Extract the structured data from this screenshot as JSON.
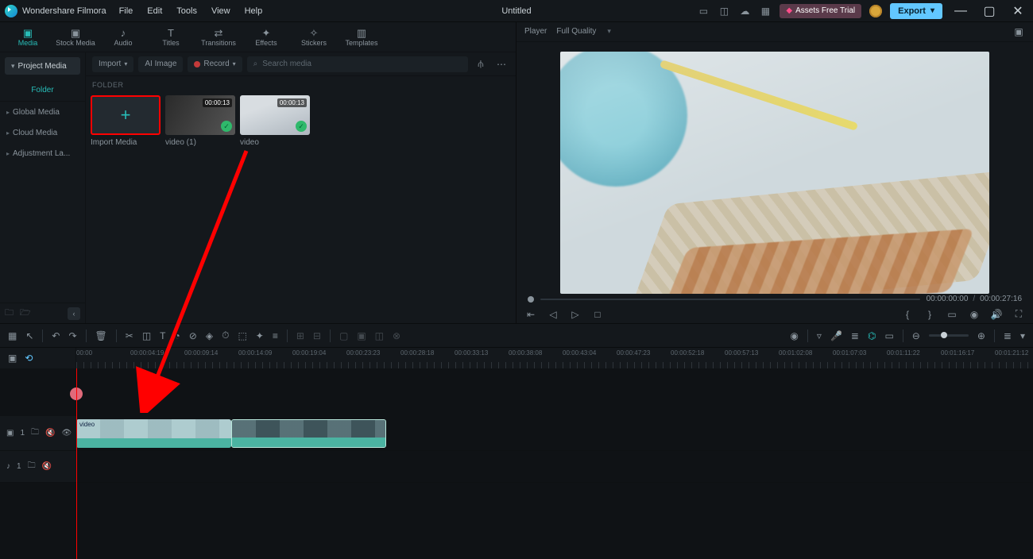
{
  "app_name": "Wondershare Filmora",
  "document_title": "Untitled",
  "menu": [
    "File",
    "Edit",
    "Tools",
    "View",
    "Help"
  ],
  "title_right": {
    "assets_badge": "Assets Free Trial",
    "export_label": "Export"
  },
  "tabs": [
    {
      "label": "Media",
      "active": true
    },
    {
      "label": "Stock Media"
    },
    {
      "label": "Audio"
    },
    {
      "label": "Titles"
    },
    {
      "label": "Transitions"
    },
    {
      "label": "Effects"
    },
    {
      "label": "Stickers"
    },
    {
      "label": "Templates"
    }
  ],
  "sidebar": {
    "project_media": "Project Media",
    "folder_header": "Folder",
    "items": [
      "Global Media",
      "Cloud Media",
      "Adjustment La..."
    ]
  },
  "browser": {
    "import": "Import",
    "ai_image": "AI Image",
    "record": "Record",
    "search_placeholder": "Search media",
    "folder_label": "FOLDER",
    "thumbs": [
      {
        "label": "Import Media",
        "duration": "",
        "type": "import"
      },
      {
        "label": "video (1)",
        "duration": "00:00:13",
        "type": "video1"
      },
      {
        "label": "video",
        "duration": "00:00:13",
        "type": "video2"
      }
    ]
  },
  "player": {
    "label": "Player",
    "quality": "Full Quality",
    "current": "00:00:00:00",
    "total": "00:00:27:16"
  },
  "timeline": {
    "ticks": [
      "00:00",
      "00:00:04:19",
      "00:00:09:14",
      "00:00:14:09",
      "00:00:19:04",
      "00:00:23:23",
      "00:00:28:18",
      "00:00:33:13",
      "00:00:38:08",
      "00:00:43:04",
      "00:00:47:23",
      "00:00:52:18",
      "00:00:57:13",
      "00:01:02:08",
      "00:01:07:03",
      "00:01:11:22",
      "00:01:16:17",
      "00:01:21:12"
    ],
    "track_video_label": "1",
    "track_audio_label": "1",
    "clip1_label": "video"
  }
}
